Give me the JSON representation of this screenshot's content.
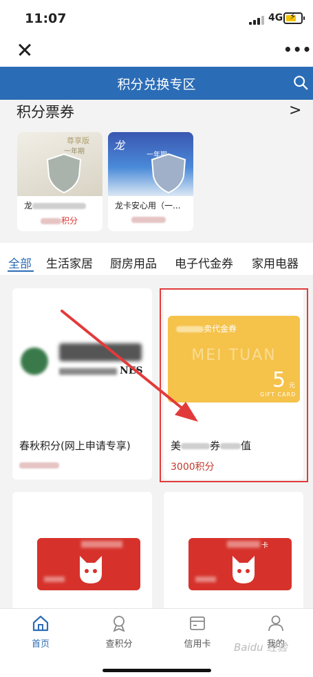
{
  "status_bar": {
    "time": "11:07",
    "network": "4G"
  },
  "header": {
    "title": "积分兑换专区"
  },
  "ticket_section": {
    "title": "积分票券",
    "items": [
      {
        "name": "龙",
        "points_suffix": "积分",
        "badge": "尊享版",
        "badge_sub": "一年期"
      },
      {
        "name": "龙卡安心用（一...",
        "badge": "龙",
        "badge_sub": "一年期"
      }
    ]
  },
  "tabs": [
    "全部",
    "生活家居",
    "厨房用品",
    "电子代金券",
    "家用电器"
  ],
  "active_tab": 0,
  "products": [
    {
      "title": "春秋积分(网上申请专享)",
      "logo_text": "NES",
      "points": ""
    },
    {
      "title_prefix": "美",
      "title_mid": "券",
      "title_suffix": "值",
      "points": "3000积分",
      "card_top": "卖代金券",
      "card_brand": "MEI TUAN",
      "card_value": "5",
      "card_unit": "元",
      "card_gift": "GIFT CARD"
    },
    {
      "title": ""
    },
    {
      "title": "",
      "card_top": "卡"
    }
  ],
  "bottom_nav": [
    {
      "label": "首页",
      "icon": "home-icon",
      "active": true
    },
    {
      "label": "查积分",
      "icon": "medal-icon",
      "active": false
    },
    {
      "label": "信用卡",
      "icon": "credit-card-icon",
      "active": false
    },
    {
      "label": "我的",
      "icon": "user-icon",
      "active": false
    }
  ],
  "watermark": "Baidu 经验",
  "colors": {
    "brand_blue": "#2b6cb6",
    "points_red": "#c0392b",
    "annotation_red": "#e23a3a",
    "meituan_yellow": "#f5c24a"
  }
}
